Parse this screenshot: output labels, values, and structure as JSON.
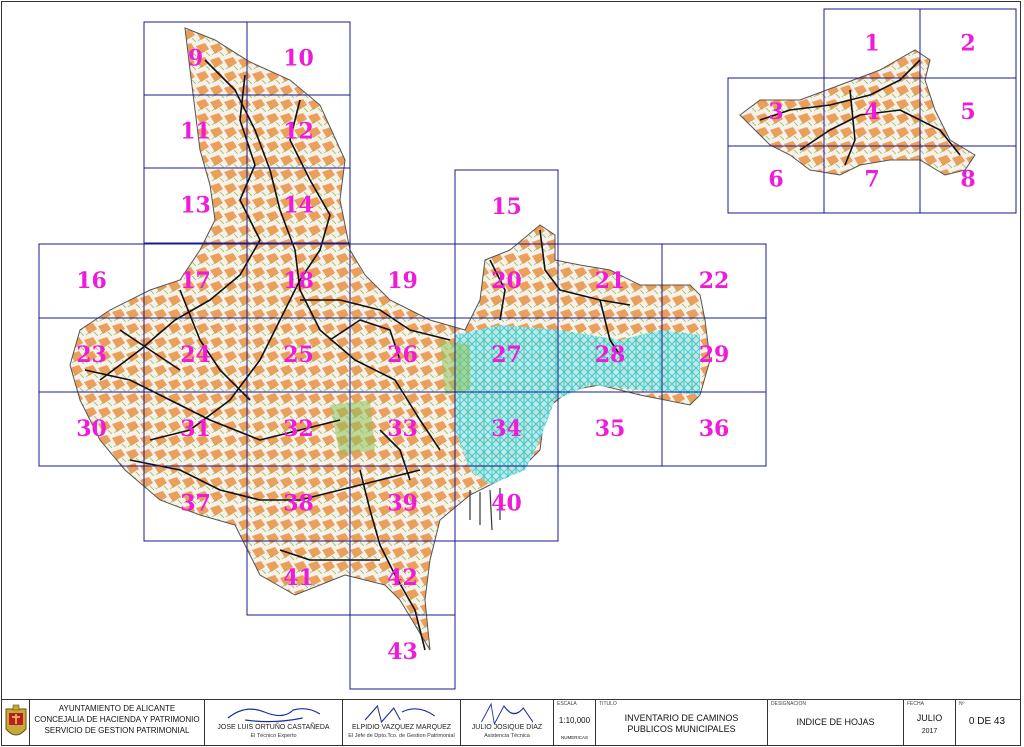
{
  "map": {
    "sheets": [
      {
        "id": "1",
        "label": "1"
      },
      {
        "id": "2",
        "label": "2"
      },
      {
        "id": "3",
        "label": "3"
      },
      {
        "id": "4",
        "label": "4"
      },
      {
        "id": "5",
        "label": "5"
      },
      {
        "id": "6",
        "label": "6"
      },
      {
        "id": "7",
        "label": "7"
      },
      {
        "id": "8",
        "label": "8"
      },
      {
        "id": "9",
        "label": "9"
      },
      {
        "id": "10",
        "label": "10"
      },
      {
        "id": "11",
        "label": "11"
      },
      {
        "id": "12",
        "label": "12"
      },
      {
        "id": "13",
        "label": "13"
      },
      {
        "id": "14",
        "label": "14"
      },
      {
        "id": "15",
        "label": "15"
      },
      {
        "id": "16",
        "label": "16"
      },
      {
        "id": "17",
        "label": "17"
      },
      {
        "id": "18",
        "label": "18"
      },
      {
        "id": "19",
        "label": "19"
      },
      {
        "id": "20",
        "label": "20"
      },
      {
        "id": "21",
        "label": "21"
      },
      {
        "id": "22",
        "label": "22"
      },
      {
        "id": "23",
        "label": "23"
      },
      {
        "id": "24",
        "label": "24"
      },
      {
        "id": "25",
        "label": "25"
      },
      {
        "id": "26",
        "label": "26"
      },
      {
        "id": "27",
        "label": "27"
      },
      {
        "id": "28",
        "label": "28"
      },
      {
        "id": "29",
        "label": "29"
      },
      {
        "id": "30",
        "label": "30"
      },
      {
        "id": "31",
        "label": "31"
      },
      {
        "id": "32",
        "label": "32"
      },
      {
        "id": "33",
        "label": "33"
      },
      {
        "id": "34",
        "label": "34"
      },
      {
        "id": "35",
        "label": "35"
      },
      {
        "id": "36",
        "label": "36"
      },
      {
        "id": "37",
        "label": "37"
      },
      {
        "id": "38",
        "label": "38"
      },
      {
        "id": "39",
        "label": "39"
      },
      {
        "id": "40",
        "label": "40"
      },
      {
        "id": "41",
        "label": "41"
      },
      {
        "id": "42",
        "label": "42"
      },
      {
        "id": "43",
        "label": "43"
      }
    ],
    "colors": {
      "label": "#ee1bd8",
      "grid": "#1a1a8c",
      "rural_parcels": "#e8822a",
      "paths": "#111111",
      "urban_streets": "#29c6c9",
      "vegetation": "#8fc25a",
      "land": "#f6f1ea",
      "outline": "#555555"
    }
  },
  "title_block": {
    "org_line1": "AYUNTAMIENTO DE ALICANTE",
    "org_line2": "CONCEJALIA DE HACIENDA Y PATRIMONIO",
    "org_line3": "SERVICIO DE GESTION PATRIMONIAL",
    "sig1_name": "JOSE LUIS ORTUÑO CASTAÑEDA",
    "sig1_role": "El Técnico Experto",
    "sig2_name": "ELPIDIO VAZQUEZ MARQUEZ",
    "sig2_role": "El Jefe de Dpto.Tco. de Gestion Patrimonial",
    "sig3_name": "JULIO JOSIQUE DIAZ",
    "sig3_role": "Asistencia Técnica",
    "scale_caption": "ESCALA",
    "scale_value": "1:10,000",
    "scale_unit": "NUMERICAS",
    "title_caption": "TITULO",
    "title_line1": "INVENTARIO DE CAMINOS",
    "title_line2": "PUBLICOS MUNICIPALES",
    "designation_caption": "DESIGNACION",
    "designation_value": "INDICE DE HOJAS",
    "date_caption": "FECHA",
    "date_month": "JULIO",
    "date_year": "2017",
    "number_caption": "Nº",
    "number_value": "0 DE 43"
  }
}
